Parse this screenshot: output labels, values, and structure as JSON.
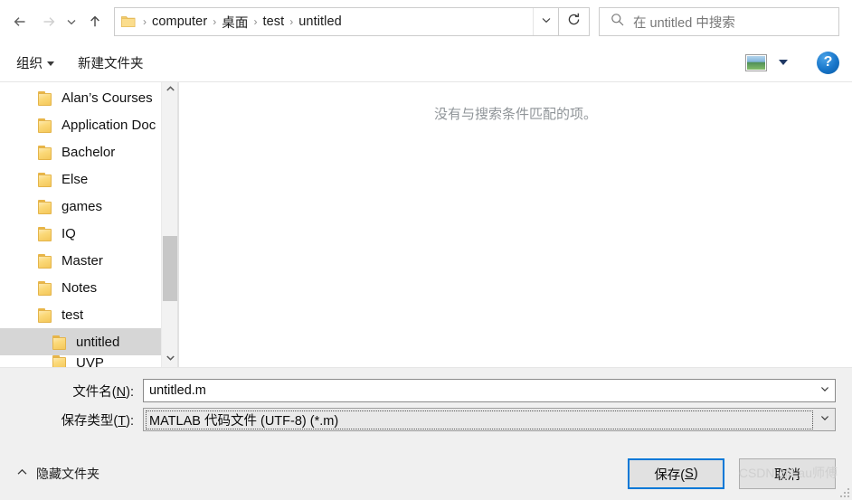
{
  "nav": {
    "back_icon": "arrow-left-icon",
    "forward_icon": "arrow-right-icon",
    "recent_icon": "chevron-down-icon",
    "up_icon": "arrow-up-icon",
    "refresh_icon": "refresh-icon",
    "address_chevron_icon": "chevron-down-icon"
  },
  "breadcrumb": {
    "folder_icon": "folder-icon",
    "separator": "›",
    "items": [
      {
        "label": "computer"
      },
      {
        "label": "桌面"
      },
      {
        "label": "test"
      },
      {
        "label": "untitled"
      }
    ]
  },
  "search": {
    "icon": "search-icon",
    "placeholder": "在 untitled 中搜索",
    "value": ""
  },
  "command_bar": {
    "organize_label": "组织",
    "new_folder_label": "新建文件夹",
    "view_icon": "view-layout-icon",
    "view_caret_icon": "caret-down-icon",
    "help_icon": "help-icon",
    "help_label": "?"
  },
  "tree": {
    "items": [
      {
        "label": "Alan’s Courses",
        "indent": false,
        "selected": false,
        "clipped": false
      },
      {
        "label": "Application Doc",
        "indent": false,
        "selected": false,
        "clipped": false
      },
      {
        "label": "Bachelor",
        "indent": false,
        "selected": false,
        "clipped": false
      },
      {
        "label": "Else",
        "indent": false,
        "selected": false,
        "clipped": false
      },
      {
        "label": "games",
        "indent": false,
        "selected": false,
        "clipped": false
      },
      {
        "label": "IQ",
        "indent": false,
        "selected": false,
        "clipped": false
      },
      {
        "label": "Master",
        "indent": false,
        "selected": false,
        "clipped": false
      },
      {
        "label": "Notes",
        "indent": false,
        "selected": false,
        "clipped": false
      },
      {
        "label": "test",
        "indent": false,
        "selected": false,
        "clipped": false
      },
      {
        "label": "untitled",
        "indent": true,
        "selected": true,
        "clipped": false
      },
      {
        "label": "UVP",
        "indent": true,
        "selected": false,
        "clipped": true
      }
    ],
    "scrollbar": {
      "up_icon": "chevron-up-icon",
      "down_icon": "chevron-down-icon"
    }
  },
  "content": {
    "empty_message": "没有与搜索条件匹配的项。"
  },
  "form": {
    "filename": {
      "label_prefix": "文件名(",
      "label_accel": "N",
      "label_suffix": "):",
      "value": "untitled.m",
      "arrow_icon": "chevron-down-icon"
    },
    "filetype": {
      "label_prefix": "保存类型(",
      "label_accel": "T",
      "label_suffix": "):",
      "value": "MATLAB 代码文件 (UTF-8) (*.m)",
      "arrow_icon": "chevron-down-icon"
    }
  },
  "footer": {
    "hide_folders_icon": "chevron-up-icon",
    "hide_folders_label": "隐藏文件夹",
    "save_prefix": "保存(",
    "save_accel": "S",
    "save_suffix": ")",
    "cancel_label": "取消",
    "watermark": "CSDN @Lau师傅",
    "resize_grip_icon": "resize-grip-icon"
  },
  "colors": {
    "accent": "#0078d7",
    "selection": "#d6d6d6",
    "chrome": "#f0f0f0",
    "folder": "#f4c75a",
    "muted_text": "#8f9498"
  }
}
